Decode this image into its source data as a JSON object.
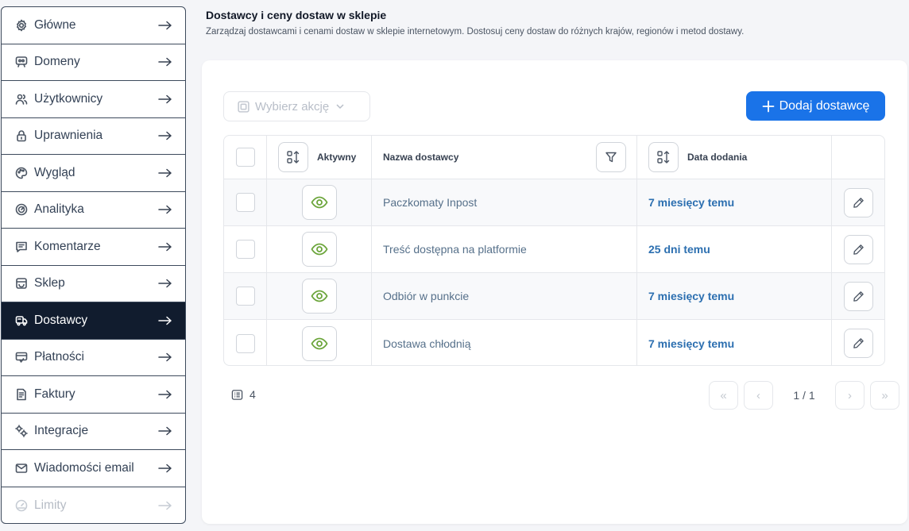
{
  "sidebar": {
    "items": [
      {
        "label": "Główne",
        "icon": "gear-icon",
        "state": "normal"
      },
      {
        "label": "Domeny",
        "icon": "globe-icon",
        "state": "normal"
      },
      {
        "label": "Użytkownicy",
        "icon": "users-icon",
        "state": "normal"
      },
      {
        "label": "Uprawnienia",
        "icon": "lock-icon",
        "state": "normal"
      },
      {
        "label": "Wygląd",
        "icon": "palette-icon",
        "state": "normal"
      },
      {
        "label": "Analityka",
        "icon": "gauge-icon",
        "state": "normal"
      },
      {
        "label": "Komentarze",
        "icon": "comment-icon",
        "state": "normal"
      },
      {
        "label": "Sklep",
        "icon": "shop-icon",
        "state": "normal"
      },
      {
        "label": "Dostawcy",
        "icon": "truck-icon",
        "state": "active"
      },
      {
        "label": "Płatności",
        "icon": "payment-icon",
        "state": "normal"
      },
      {
        "label": "Faktury",
        "icon": "invoice-icon",
        "state": "normal"
      },
      {
        "label": "Integracje",
        "icon": "integration-icon",
        "state": "normal"
      },
      {
        "label": "Wiadomości email",
        "icon": "mail-icon",
        "state": "normal"
      },
      {
        "label": "Limity",
        "icon": "limit-icon",
        "state": "disabled"
      }
    ]
  },
  "header": {
    "title": "Dostawcy i ceny dostaw w sklepie",
    "description": "Zarządzaj dostawcami i cenami dostaw w sklepie internetowym. Dostosuj ceny dostaw do różnych krajów, regionów i metod dostawy."
  },
  "toolbar": {
    "action_select_placeholder": "Wybierz akcję",
    "add_button_label": "Dodaj dostawcę"
  },
  "table": {
    "columns": {
      "active": "Aktywny",
      "name": "Nazwa dostawcy",
      "date": "Data dodania"
    },
    "rows": [
      {
        "name": "Paczkomaty Inpost",
        "date": "7 miesięcy temu",
        "active": true
      },
      {
        "name": "Treść dostępna na platformie",
        "date": "25 dni temu",
        "active": true
      },
      {
        "name": "Odbiór w punkcie",
        "date": "7 miesięcy temu",
        "active": true
      },
      {
        "name": "Dostawa chłodnią",
        "date": "7 miesięcy temu",
        "active": true
      }
    ]
  },
  "footer": {
    "total_count": "4",
    "page_info": "1 / 1",
    "first_label": "«",
    "prev_label": "‹",
    "next_label": "›",
    "last_label": "»"
  },
  "colors": {
    "accent": "#1a73e8",
    "active_nav": "#111c2e",
    "eye_icon": "#6ba53a",
    "date_text": "#2c6fb0"
  }
}
